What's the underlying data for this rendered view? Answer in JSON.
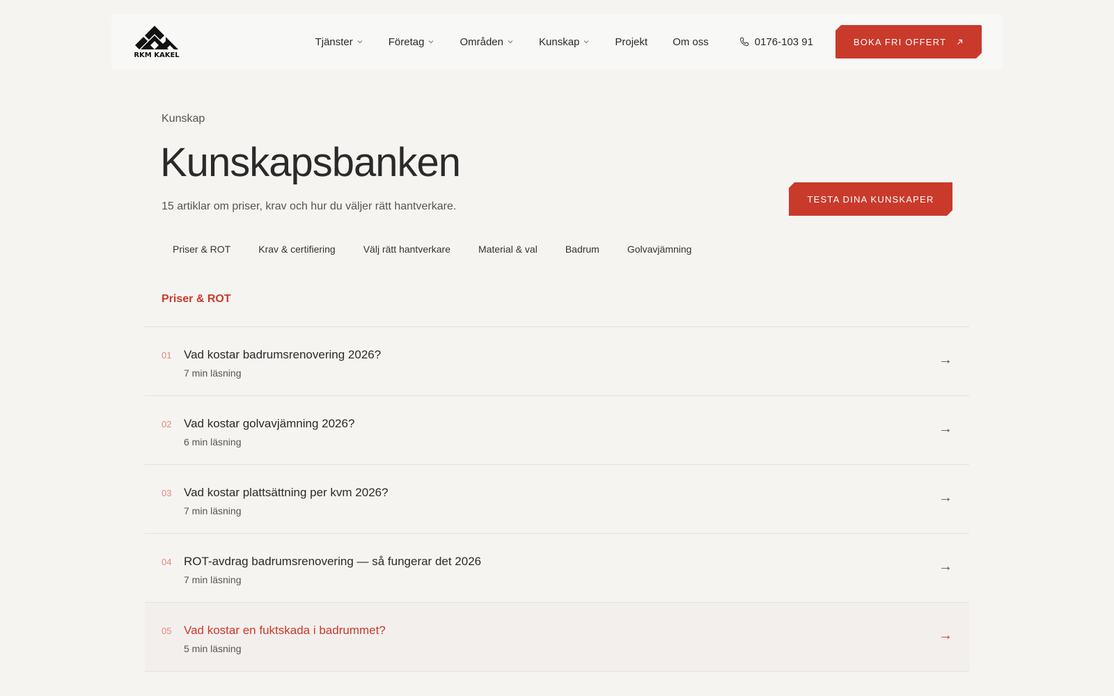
{
  "header": {
    "logo_text": "RKM KAKEL",
    "nav": [
      {
        "label": "Tjänster",
        "dropdown": true
      },
      {
        "label": "Företag",
        "dropdown": true
      },
      {
        "label": "Områden",
        "dropdown": true
      },
      {
        "label": "Kunskap",
        "dropdown": true
      },
      {
        "label": "Projekt",
        "dropdown": false
      },
      {
        "label": "Om oss",
        "dropdown": false
      }
    ],
    "phone": "0176-103 91",
    "cta_label": "Boka fri offert"
  },
  "hero": {
    "breadcrumb": "Kunskap",
    "title": "Kunskapsbanken",
    "subtitle": "15 artiklar om priser, krav och hur du väljer rätt hantverkare.",
    "quiz_button": "Testa dina kunskaper"
  },
  "filters": [
    "Priser & ROT",
    "Krav & certifiering",
    "Välj rätt hantverkare",
    "Material & val",
    "Badrum",
    "Golvavjämning"
  ],
  "section": {
    "title": "Priser & ROT",
    "articles": [
      {
        "num": "01",
        "title": "Vad kostar badrumsrenovering 2026?",
        "meta": "7 min läsning"
      },
      {
        "num": "02",
        "title": "Vad kostar golvavjämning 2026?",
        "meta": "6 min läsning"
      },
      {
        "num": "03",
        "title": "Vad kostar plattsättning per kvm 2026?",
        "meta": "7 min läsning"
      },
      {
        "num": "04",
        "title": "ROT-avdrag badrumsrenovering — så fungerar det 2026",
        "meta": "7 min läsning"
      },
      {
        "num": "05",
        "title": "Vad kostar en fuktskada i badrummet?",
        "meta": "5 min läsning"
      }
    ],
    "active_index": 4
  },
  "colors": {
    "accent": "#c93a2b",
    "background": "#f6f4f1",
    "text": "#2a2a2a"
  }
}
